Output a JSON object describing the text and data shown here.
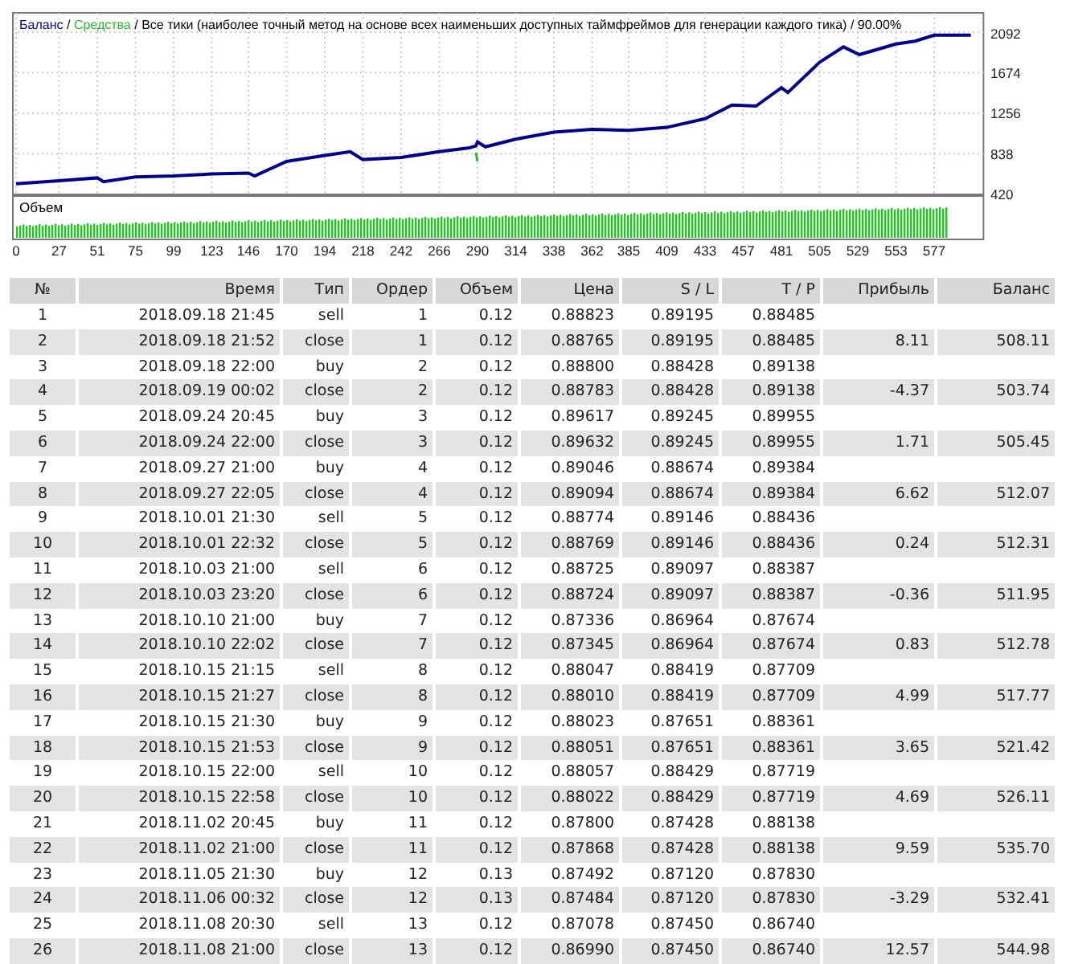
{
  "chart": {
    "legend_separators": [
      "/",
      "/",
      "/"
    ],
    "legend_texts": [
      "Все тики (наиболее точный метод на основе всех наименьших доступных таймфреймов для генерации каждого тика)",
      "90.00%"
    ],
    "chart_data": {
      "type": "line",
      "grid": true,
      "x": [
        0,
        27,
        51,
        55,
        75,
        99,
        123,
        146,
        150,
        170,
        194,
        210,
        218,
        242,
        266,
        285,
        289,
        290,
        295,
        314,
        338,
        362,
        385,
        409,
        433,
        450,
        465,
        481,
        485,
        505,
        520,
        530,
        553,
        565,
        577,
        600
      ],
      "xlim": [
        0,
        608
      ],
      "ylim": [
        420,
        2092
      ],
      "xticks": [
        0,
        27,
        51,
        75,
        99,
        123,
        146,
        170,
        194,
        218,
        242,
        266,
        290,
        314,
        338,
        362,
        385,
        409,
        433,
        457,
        481,
        505,
        529,
        553,
        577
      ],
      "yticks": [
        420,
        838,
        1256,
        1674,
        2092
      ],
      "series": [
        {
          "name": "Баланс",
          "color": "#00008b",
          "values": [
            530,
            560,
            590,
            550,
            600,
            610,
            630,
            640,
            610,
            760,
            820,
            860,
            780,
            800,
            860,
            900,
            920,
            960,
            910,
            990,
            1060,
            1090,
            1080,
            1110,
            1200,
            1340,
            1330,
            1520,
            1470,
            1780,
            1940,
            1860,
            1970,
            2000,
            2060,
            2060
          ]
        },
        {
          "name": "Средства",
          "color": "#2fb52f",
          "values": [
            null,
            null,
            null,
            null,
            null,
            null,
            null,
            null,
            null,
            null,
            null,
            null,
            null,
            null,
            null,
            null,
            850,
            760,
            null,
            null,
            null,
            null,
            null,
            null,
            null,
            null,
            null,
            null,
            null,
            null,
            null,
            null,
            null,
            null,
            null,
            null
          ]
        }
      ]
    },
    "volume_panel": {
      "title": "Объем"
    }
  },
  "table": {
    "columns": [
      "№",
      "Время",
      "Тип",
      "Ордер",
      "Объем",
      "Цена",
      "S / L",
      "T / P",
      "Прибыль",
      "Баланс"
    ],
    "rows": [
      {
        "no": "1",
        "time": "2018.09.18 21:45",
        "type": "sell",
        "order": "1",
        "volume": "0.12",
        "price": "0.88823",
        "sl": "0.89195",
        "tp": "0.88485"
      },
      {
        "no": "2",
        "time": "2018.09.18 21:52",
        "type": "close",
        "order": "1",
        "volume": "0.12",
        "price": "0.88765",
        "sl": "0.89195",
        "tp": "0.88485",
        "profit": "8.11",
        "balance": "508.11"
      },
      {
        "no": "3",
        "time": "2018.09.18 22:00",
        "type": "buy",
        "order": "2",
        "volume": "0.12",
        "price": "0.88800",
        "sl": "0.88428",
        "tp": "0.89138"
      },
      {
        "no": "4",
        "time": "2018.09.19 00:02",
        "type": "close",
        "order": "2",
        "volume": "0.12",
        "price": "0.88783",
        "sl": "0.88428",
        "tp": "0.89138",
        "profit": "-4.37",
        "balance": "503.74"
      },
      {
        "no": "5",
        "time": "2018.09.24 20:45",
        "type": "buy",
        "order": "3",
        "volume": "0.12",
        "price": "0.89617",
        "sl": "0.89245",
        "tp": "0.89955"
      },
      {
        "no": "6",
        "time": "2018.09.24 22:00",
        "type": "close",
        "order": "3",
        "volume": "0.12",
        "price": "0.89632",
        "sl": "0.89245",
        "tp": "0.89955",
        "profit": "1.71",
        "balance": "505.45"
      },
      {
        "no": "7",
        "time": "2018.09.27 21:00",
        "type": "buy",
        "order": "4",
        "volume": "0.12",
        "price": "0.89046",
        "sl": "0.88674",
        "tp": "0.89384"
      },
      {
        "no": "8",
        "time": "2018.09.27 22:05",
        "type": "close",
        "order": "4",
        "volume": "0.12",
        "price": "0.89094",
        "sl": "0.88674",
        "tp": "0.89384",
        "profit": "6.62",
        "balance": "512.07"
      },
      {
        "no": "9",
        "time": "2018.10.01 21:30",
        "type": "sell",
        "order": "5",
        "volume": "0.12",
        "price": "0.88774",
        "sl": "0.89146",
        "tp": "0.88436"
      },
      {
        "no": "10",
        "time": "2018.10.01 22:32",
        "type": "close",
        "order": "5",
        "volume": "0.12",
        "price": "0.88769",
        "sl": "0.89146",
        "tp": "0.88436",
        "profit": "0.24",
        "balance": "512.31"
      },
      {
        "no": "11",
        "time": "2018.10.03 21:00",
        "type": "sell",
        "order": "6",
        "volume": "0.12",
        "price": "0.88725",
        "sl": "0.89097",
        "tp": "0.88387"
      },
      {
        "no": "12",
        "time": "2018.10.03 23:20",
        "type": "close",
        "order": "6",
        "volume": "0.12",
        "price": "0.88724",
        "sl": "0.89097",
        "tp": "0.88387",
        "profit": "-0.36",
        "balance": "511.95"
      },
      {
        "no": "13",
        "time": "2018.10.10 21:00",
        "type": "buy",
        "order": "7",
        "volume": "0.12",
        "price": "0.87336",
        "sl": "0.86964",
        "tp": "0.87674"
      },
      {
        "no": "14",
        "time": "2018.10.10 22:02",
        "type": "close",
        "order": "7",
        "volume": "0.12",
        "price": "0.87345",
        "sl": "0.86964",
        "tp": "0.87674",
        "profit": "0.83",
        "balance": "512.78"
      },
      {
        "no": "15",
        "time": "2018.10.15 21:15",
        "type": "sell",
        "order": "8",
        "volume": "0.12",
        "price": "0.88047",
        "sl": "0.88419",
        "tp": "0.87709"
      },
      {
        "no": "16",
        "time": "2018.10.15 21:27",
        "type": "close",
        "order": "8",
        "volume": "0.12",
        "price": "0.88010",
        "sl": "0.88419",
        "tp": "0.87709",
        "profit": "4.99",
        "balance": "517.77"
      },
      {
        "no": "17",
        "time": "2018.10.15 21:30",
        "type": "buy",
        "order": "9",
        "volume": "0.12",
        "price": "0.88023",
        "sl": "0.87651",
        "tp": "0.88361"
      },
      {
        "no": "18",
        "time": "2018.10.15 21:53",
        "type": "close",
        "order": "9",
        "volume": "0.12",
        "price": "0.88051",
        "sl": "0.87651",
        "tp": "0.88361",
        "profit": "3.65",
        "balance": "521.42"
      },
      {
        "no": "19",
        "time": "2018.10.15 22:00",
        "type": "sell",
        "order": "10",
        "volume": "0.12",
        "price": "0.88057",
        "sl": "0.88429",
        "tp": "0.87719"
      },
      {
        "no": "20",
        "time": "2018.10.15 22:58",
        "type": "close",
        "order": "10",
        "volume": "0.12",
        "price": "0.88022",
        "sl": "0.88429",
        "tp": "0.87719",
        "profit": "4.69",
        "balance": "526.11"
      },
      {
        "no": "21",
        "time": "2018.11.02 20:45",
        "type": "buy",
        "order": "11",
        "volume": "0.12",
        "price": "0.87800",
        "sl": "0.87428",
        "tp": "0.88138"
      },
      {
        "no": "22",
        "time": "2018.11.02 21:00",
        "type": "close",
        "order": "11",
        "volume": "0.12",
        "price": "0.87868",
        "sl": "0.87428",
        "tp": "0.88138",
        "profit": "9.59",
        "balance": "535.70"
      },
      {
        "no": "23",
        "time": "2018.11.05 21:30",
        "type": "buy",
        "order": "12",
        "volume": "0.13",
        "price": "0.87492",
        "sl": "0.87120",
        "tp": "0.87830"
      },
      {
        "no": "24",
        "time": "2018.11.06 00:32",
        "type": "close",
        "order": "12",
        "volume": "0.13",
        "price": "0.87484",
        "sl": "0.87120",
        "tp": "0.87830",
        "profit": "-3.29",
        "balance": "532.41"
      },
      {
        "no": "25",
        "time": "2018.11.08 20:30",
        "type": "sell",
        "order": "13",
        "volume": "0.12",
        "price": "0.87078",
        "sl": "0.87450",
        "tp": "0.86740"
      },
      {
        "no": "26",
        "time": "2018.11.08 21:00",
        "type": "close",
        "order": "13",
        "volume": "0.12",
        "price": "0.86990",
        "sl": "0.87450",
        "tp": "0.86740",
        "profit": "12.57",
        "balance": "544.98"
      }
    ]
  }
}
